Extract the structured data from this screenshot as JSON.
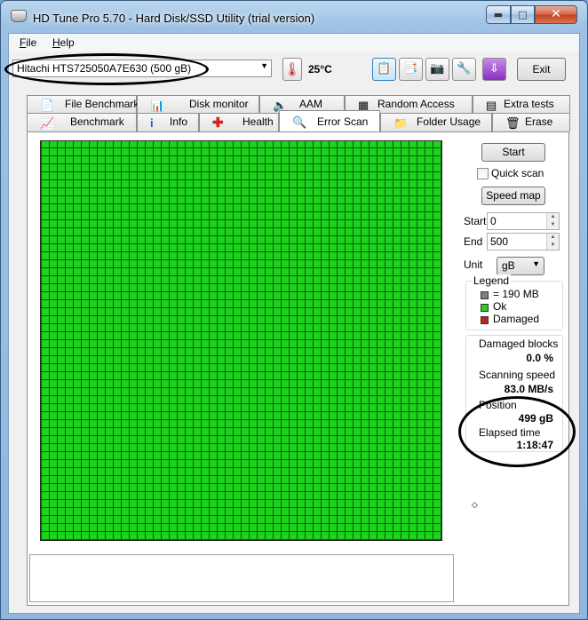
{
  "window": {
    "title": "HD Tune Pro 5.70 - Hard Disk/SSD Utility (trial version)",
    "controls": {
      "minimize": "▬",
      "maximize": "□",
      "close": "✕"
    }
  },
  "menu": {
    "file": "File",
    "help": "Help"
  },
  "toolbar": {
    "drive": "Hitachi HTS725050A7E630 (500 gB)",
    "temperature": "25°C",
    "exit_label": "Exit",
    "icons": [
      "copy-info-icon",
      "copy-screen-icon",
      "camera-icon",
      "options-icon",
      "download-icon"
    ]
  },
  "tabs": {
    "row1": [
      "File Benchmark",
      "Disk monitor",
      "AAM",
      "Random Access",
      "Extra tests"
    ],
    "row2": [
      "Benchmark",
      "Info",
      "Health",
      "Error Scan",
      "Folder Usage",
      "Erase"
    ],
    "active": "Error Scan"
  },
  "scan": {
    "start_button": "Start",
    "quick_scan_label": "Quick scan",
    "quick_scan_checked": false,
    "speed_map_button": "Speed map",
    "start_label": "Start",
    "start_value": "0",
    "end_label": "End",
    "end_value": "500",
    "unit_label": "Unit",
    "unit_value": "gB"
  },
  "legend": {
    "title": "Legend",
    "block_size": "= 190 MB",
    "ok": "Ok",
    "damaged": "Damaged",
    "colors": {
      "block": "#808080",
      "ok": "#1dd31d",
      "damaged": "#c42020"
    }
  },
  "stats": {
    "damaged_blocks_label": "Damaged blocks",
    "damaged_blocks_value": "0.0 %",
    "scanning_speed_label": "Scanning speed",
    "scanning_speed_value": "83.0 MB/s",
    "position_label": "Position",
    "position_value": "499 gB",
    "elapsed_label": "Elapsed time",
    "elapsed_value": "1:18:47"
  }
}
